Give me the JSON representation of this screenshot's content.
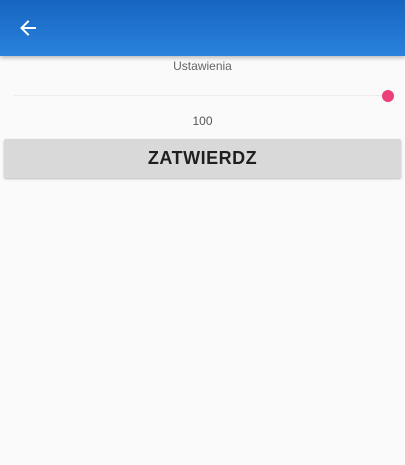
{
  "toolbar": {
    "back_icon": "arrow-left-icon",
    "color_top": "#1565c0",
    "color_bottom": "#2a82dc"
  },
  "settings": {
    "label": "Ustawienia",
    "slider": {
      "value": "100",
      "level": 1.0,
      "thumb_color": "#ec407a"
    },
    "confirm_label": "ZATWIERDZ"
  }
}
